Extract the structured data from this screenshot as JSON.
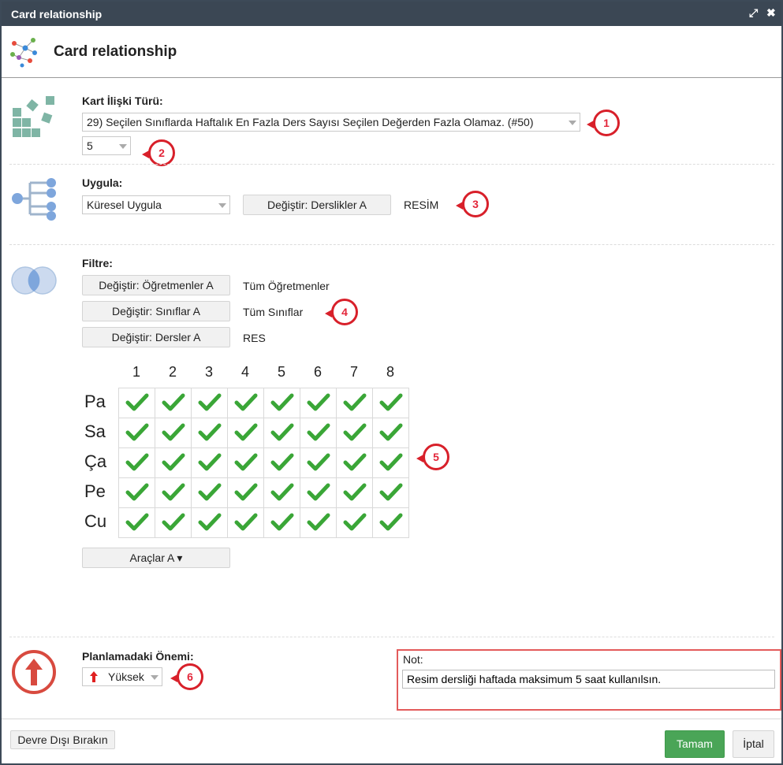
{
  "window": {
    "title": "Card relationship"
  },
  "header": {
    "title": "Card relationship"
  },
  "relation": {
    "label": "Kart İlişki Türü:",
    "type_value": "29) Seçilen Sınıflarda Haftalık En Fazla Ders Sayısı Seçilen Değerden Fazla Olamaz. (#50)",
    "number_value": "5"
  },
  "apply": {
    "label": "Uygula:",
    "mode_value": "Küresel Uygula",
    "change_button": "Değiştir: Derslikler A",
    "selected": "RESİM"
  },
  "filter": {
    "label": "Filtre:",
    "rows": [
      {
        "button": "Değiştir: Öğretmenler A",
        "value": "Tüm Öğretmenler"
      },
      {
        "button": "Değiştir: Sınıflar A",
        "value": "Tüm Sınıflar"
      },
      {
        "button": "Değiştir: Dersler A",
        "value": "RES"
      }
    ]
  },
  "schedule": {
    "periods": [
      "1",
      "2",
      "3",
      "4",
      "5",
      "6",
      "7",
      "8"
    ],
    "days": [
      "Pa",
      "Sa",
      "Ça",
      "Pe",
      "Cu"
    ],
    "all_checked": true,
    "tools_button": "Araçlar A ▾"
  },
  "importance": {
    "label": "Planlamadaki Önemi:",
    "value": "Yüksek"
  },
  "note": {
    "label": "Not:",
    "value": "Resim dersliği haftada maksimum 5 saat kullanılsın."
  },
  "footer": {
    "disable_button": "Devre Dışı Bırakın",
    "ok_button": "Tamam",
    "cancel_button": "İptal"
  },
  "callouts": [
    "1",
    "2",
    "3",
    "4",
    "5",
    "6"
  ],
  "colors": {
    "titlebar": "#3b4754",
    "accent_green": "#4aa557",
    "check_green": "#3aa637",
    "callout_red": "#e3263a"
  }
}
